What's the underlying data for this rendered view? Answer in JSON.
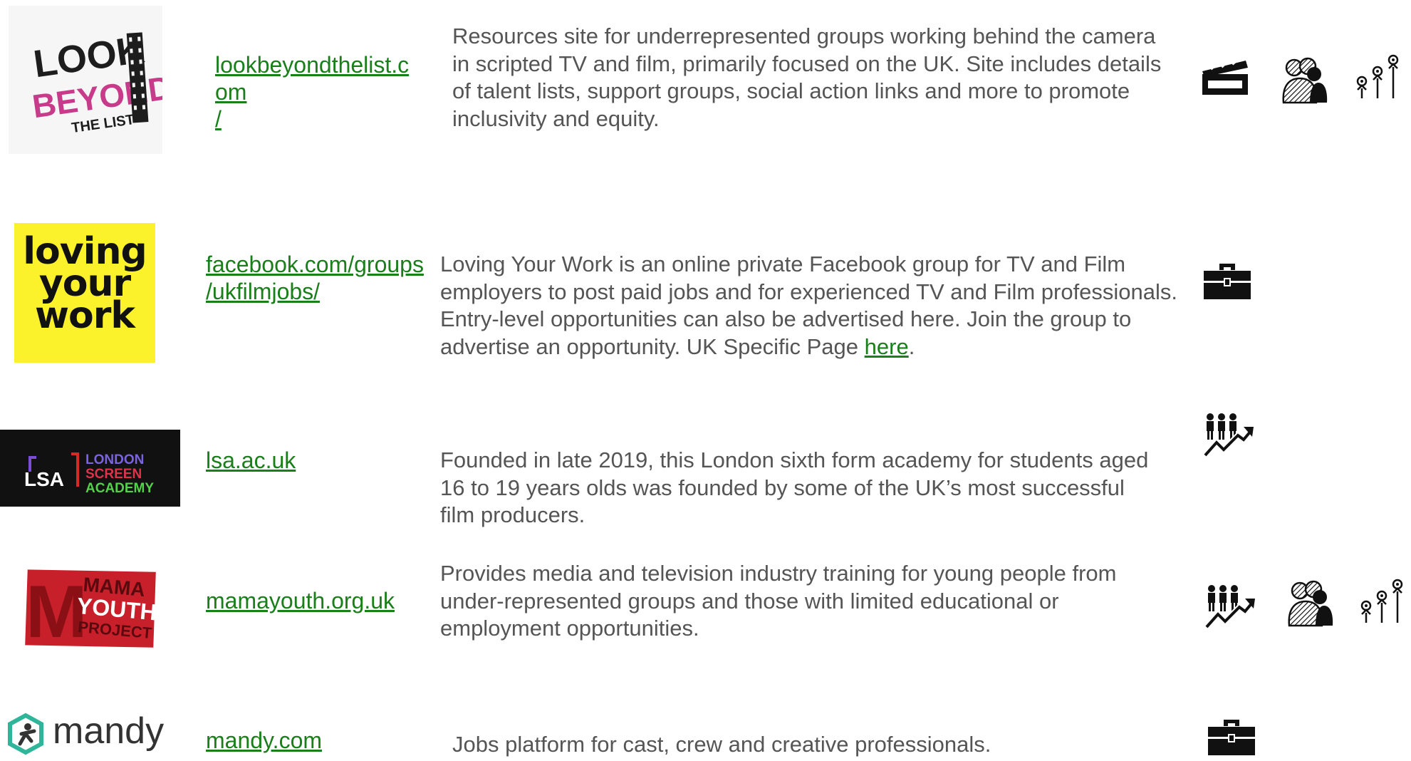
{
  "colors": {
    "link": "#1a7f1a",
    "text": "#555555",
    "lyw_bg": "#fbf22c",
    "lsa_bg": "#111111",
    "mama_red": "#c8202a",
    "mandy_teal": "#2fb59a"
  },
  "rows": [
    {
      "logo": {
        "alt": "Look Beyond The List logo",
        "lines": [
          "LOOK",
          "BEYOND",
          "THE LIST"
        ]
      },
      "link": "lookbeyondthelist.c\nom\n/",
      "desc": "Resources site for underrepresented groups working behind the camera in scripted TV and film, primarily focused on the UK. Site includes details of talent lists, support groups, social action links and more to promote inclusivity and equity.",
      "icons": [
        "clapperboard-icon",
        "community-group-icon",
        "funding-growth-icon"
      ]
    },
    {
      "logo": {
        "alt": "Loving Your Work logo",
        "lines": [
          "loving",
          "your",
          "work"
        ]
      },
      "link": "facebook.com/groups\n/ukfilmjobs/",
      "desc": "Loving Your Work is an online private Facebook group for TV and Film employers to post paid jobs and for experienced TV and Film professionals. Entry-level opportunities can also be advertised here. Join the group to advertise an opportunity. UK Specific Page ",
      "desc_link": "here",
      "desc_end": ".",
      "icons": [
        "briefcase-icon"
      ]
    },
    {
      "logo": {
        "alt": "London Screen Academy logo",
        "abbr": "LSA",
        "lines": [
          "LONDON",
          "SCREEN",
          "ACADEMY"
        ]
      },
      "link": "lsa.ac.uk",
      "desc": "Founded in late 2019, this London sixth form academy for students aged 16 to 19 years olds was founded by some of the UK’s most successful film producers.",
      "icons": [
        "training-progress-icon"
      ]
    },
    {
      "logo": {
        "alt": "MAMA Youth Project logo",
        "letter": "M",
        "lines": [
          "MAMA",
          "YOUTH",
          "PROJECT"
        ]
      },
      "link": "mamayouth.org.uk",
      "desc": "Provides media and television industry training for young people from under-represented groups and those with limited educational or employment opportunities.",
      "icons": [
        "training-progress-icon",
        "community-group-icon",
        "funding-growth-icon"
      ]
    },
    {
      "logo": {
        "alt": "Mandy logo",
        "word": "mandy"
      },
      "link": "mandy.com",
      "desc": "Jobs platform for cast, crew and creative professionals.",
      "icons": [
        "briefcase-icon"
      ]
    }
  ]
}
